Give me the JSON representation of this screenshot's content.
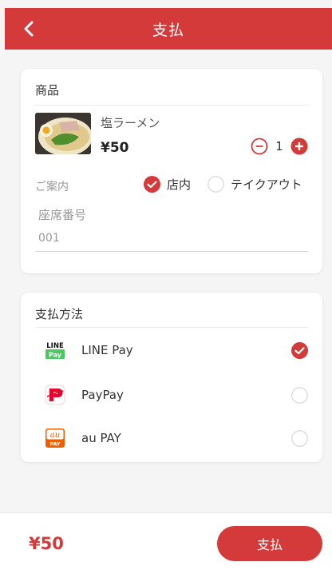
{
  "header": {
    "title": "支払"
  },
  "product": {
    "section_title": "商品",
    "item_name": "塩ラーメン",
    "item_price": "¥50",
    "quantity": "1",
    "guide_label": "ご案内",
    "dine_options": [
      {
        "label": "店内",
        "selected": true
      },
      {
        "label": "テイクアウト",
        "selected": false
      }
    ],
    "seat_label": "座席番号",
    "seat_value": "001"
  },
  "payment": {
    "section_title": "支払方法",
    "methods": [
      {
        "label": "LINE Pay",
        "logo_text_top": "LINE",
        "logo_text_bottom": "Pay",
        "selected": true
      },
      {
        "label": "PayPay",
        "selected": false
      },
      {
        "label": "au PAY",
        "logo_text_top": "au",
        "logo_text_bottom": "PAY",
        "selected": false
      }
    ]
  },
  "footer": {
    "total": "¥50",
    "pay_label": "支払"
  },
  "colors": {
    "accent": "#d43a3a",
    "line_green": "#4cc764",
    "au_orange": "#eb6100"
  }
}
